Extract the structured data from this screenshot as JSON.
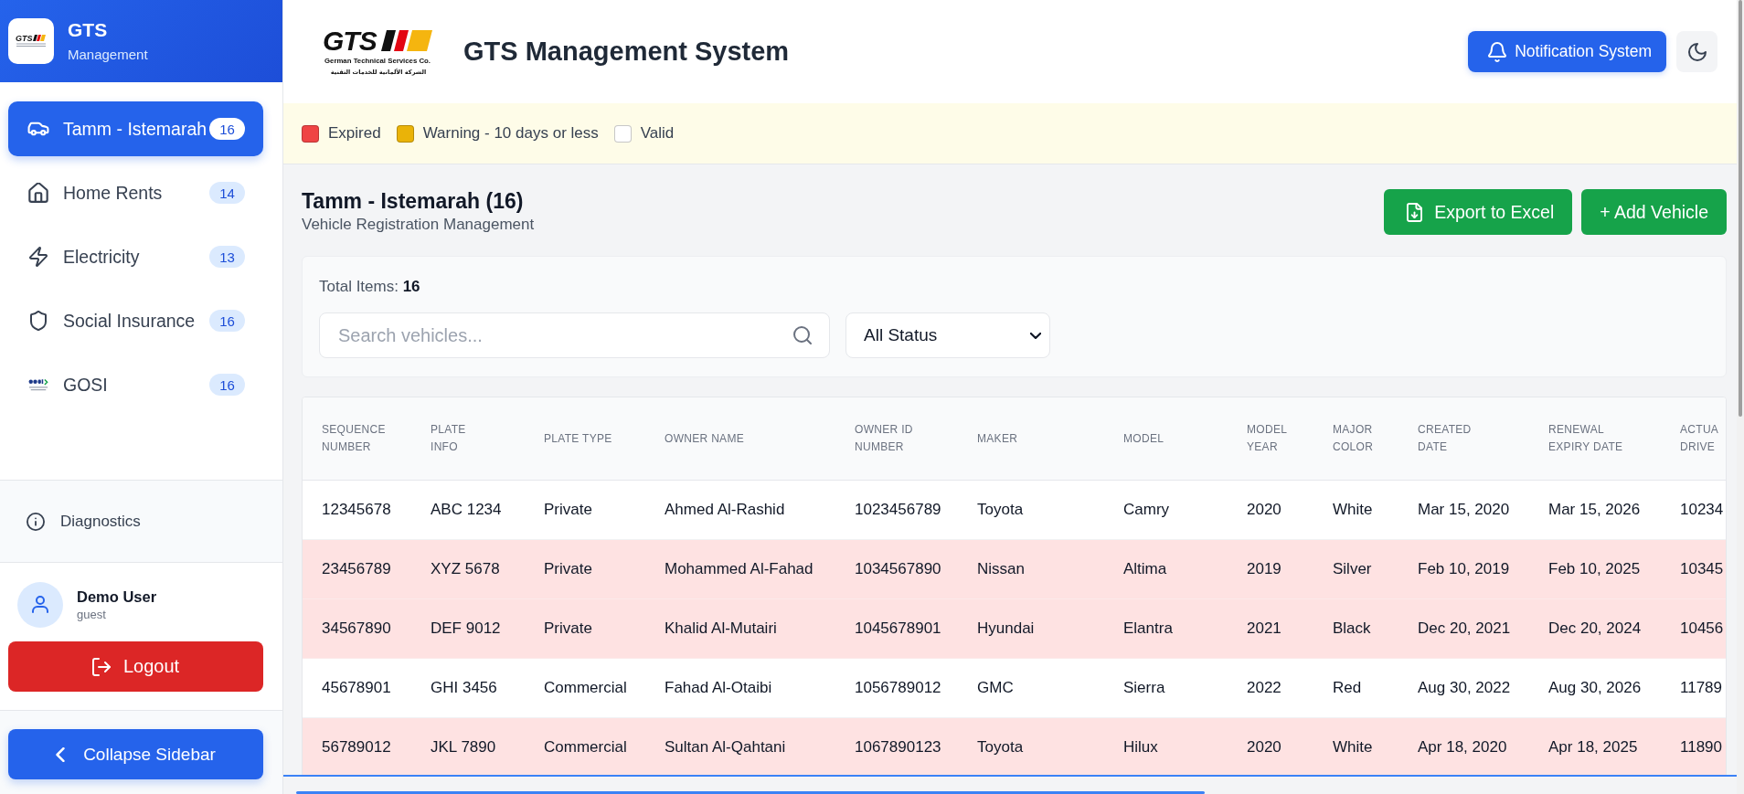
{
  "sidebar": {
    "brand": {
      "logo_text": "GTS",
      "title": "GTS",
      "subtitle": "Management"
    },
    "nav": [
      {
        "label": "Tamm - Istemarah",
        "count": "16",
        "selected": true
      },
      {
        "label": "Home Rents",
        "count": "14",
        "selected": false
      },
      {
        "label": "Electricity",
        "count": "13",
        "selected": false
      },
      {
        "label": "Social Insurance",
        "count": "16",
        "selected": false
      },
      {
        "label": "GOSI",
        "count": "16",
        "selected": false
      }
    ],
    "diagnostics": "Diagnostics",
    "user": {
      "name": "Demo User",
      "role": "guest"
    },
    "logout": "Logout",
    "collapse": "Collapse Sidebar"
  },
  "header": {
    "logo": {
      "wordmark": "GTS",
      "name": "German Technical Services Co.",
      "arabic_name": "الشركة الألمانية للخدمات التقنية"
    },
    "title": "GTS Management System",
    "notification_button": "Notification System"
  },
  "legend": [
    {
      "label": "Expired",
      "color": "#ef4444"
    },
    {
      "label": "Warning - 10 days or less",
      "color": "#eab308"
    },
    {
      "label": "Valid",
      "color": "#ffffff"
    }
  ],
  "page": {
    "title": "Tamm - Istemarah (16)",
    "subtitle": "Vehicle Registration Management",
    "buttons": [
      {
        "kind": "export",
        "label": "Export to Excel"
      },
      {
        "kind": "add",
        "label": "+ Add Vehicle"
      }
    ]
  },
  "filters": {
    "total_items": "Total Items: **16**",
    "search": {
      "placeholder": "Search vehicles..."
    },
    "status_select": {
      "value": "All Status"
    }
  },
  "table": {
    "columns": [
      "SEQUENCE NUMBER",
      "PLATE INFO",
      "PLATE TYPE",
      "OWNER NAME",
      "OWNER ID NUMBER",
      "MAKER",
      "MODEL",
      "MODEL YEAR",
      "MAJOR COLOR",
      "CREATED DATE",
      "RENEWAL EXPIRY DATE",
      "ACTUA DRIVE"
    ],
    "rows": [
      {
        "expired": false,
        "cells": [
          "12345678",
          "ABC 1234",
          "Private",
          "Ahmed Al-Rashid",
          "1023456789",
          "Toyota",
          "Camry",
          "2020",
          "White",
          "Mar 15, 2020",
          "Mar 15, 2026",
          "10234"
        ]
      },
      {
        "expired": true,
        "cells": [
          "23456789",
          "XYZ 5678",
          "Private",
          "Mohammed Al-Fahad",
          "1034567890",
          "Nissan",
          "Altima",
          "2019",
          "Silver",
          "Feb 10, 2019",
          "Feb 10, 2025",
          "10345"
        ]
      },
      {
        "expired": true,
        "cells": [
          "34567890",
          "DEF 9012",
          "Private",
          "Khalid Al-Mutairi",
          "1045678901",
          "Hyundai",
          "Elantra",
          "2021",
          "Black",
          "Dec 20, 2021",
          "Dec 20, 2024",
          "10456"
        ]
      },
      {
        "expired": false,
        "cells": [
          "45678901",
          "GHI 3456",
          "Commercial",
          "Fahad Al-Otaibi",
          "1056789012",
          "GMC",
          "Sierra",
          "2022",
          "Red",
          "Aug 30, 2022",
          "Aug 30, 2026",
          "11789"
        ]
      },
      {
        "expired": true,
        "cells": [
          "56789012",
          "JKL 7890",
          "Commercial",
          "Sultan Al-Qahtani",
          "1067890123",
          "Toyota",
          "Hilux",
          "2020",
          "White",
          "Apr 18, 2020",
          "Apr 18, 2025",
          "11890"
        ]
      }
    ]
  }
}
